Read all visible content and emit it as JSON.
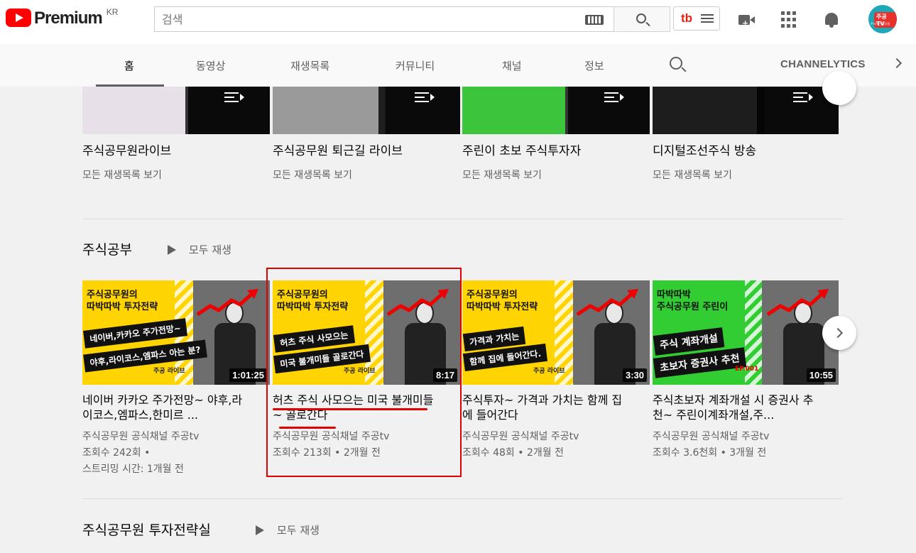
{
  "masthead": {
    "logo_text": "Premium",
    "country": "KR",
    "search_placeholder": "검색",
    "tubebuddy_label": "tb"
  },
  "channel_tabs": {
    "items": [
      "홈",
      "동영상",
      "재생목록",
      "커뮤니티",
      "채널",
      "정보"
    ],
    "active": "홈",
    "extension": "CHANNELYTICS"
  },
  "playlists": [
    {
      "title": "주식공무원라이브",
      "link": "모든 재생목록 보기"
    },
    {
      "title": "주식공무원 퇴근길 라이브",
      "link": "모든 재생목록 보기"
    },
    {
      "title": "주린이 초보 주식투자자",
      "link": "모든 재생목록 보기"
    },
    {
      "title": "디지털조선주식 방송",
      "link": "모든 재생목록 보기"
    }
  ],
  "section1": {
    "title": "주식공부",
    "play_all": "모두 재생",
    "videos": [
      {
        "title": "네이버 카카오 주가전망~ 야후,라이코스,엠파스,한미르 ...",
        "channel": "주식공무원 공식채널 주공tv",
        "meta1": "조회수 242회 •",
        "meta2": "스트리밍 시간: 1개월 전",
        "duration": "1:01:25",
        "thumb_headline": "주식공무원의\n따박따박 투자전략",
        "thumb_banner1": "네이버,카카오 주가전망~",
        "thumb_banner2": "야후,라이코스,엠파스 아는 분?",
        "thumb_brand": "주공 라이브"
      },
      {
        "title": "허츠 주식 사모으는 미국 불개미들~ 골로간다",
        "channel": "주식공무원 공식채널 주공tv",
        "meta1": "조회수 213회 • 2개월 전",
        "duration": "8:17",
        "thumb_headline": "주식공무원의\n따박따박 투자전략",
        "thumb_banner1": "허츠 주식 사모으는",
        "thumb_banner2": "미국 불개미들 골로간다",
        "thumb_brand": "주공 라이브"
      },
      {
        "title": "주식투자~ 가격과 가치는 함께 집에 들어간다",
        "channel": "주식공무원 공식채널 주공tv",
        "meta1": "조회수 48회 • 2개월 전",
        "duration": "3:30",
        "thumb_headline": "주식공무원의\n따박따박 투자전략",
        "thumb_banner1": "가격과 가치는",
        "thumb_banner2": "함께 집에 들어간다.",
        "thumb_brand": "주공 라이브"
      },
      {
        "title": "주식초보자 계좌개설 시 증권사 추천~ 주린이계좌개설,주...",
        "channel": "주식공무원 공식채널 주공tv",
        "meta1": "조회수 3.6천회 • 3개월 전",
        "duration": "10:55",
        "thumb_headline": "따박따박\n주식공무원 주린이",
        "thumb_banner1": "주식 계좌개설",
        "thumb_banner2": "초보자 증권사 추천",
        "thumb_brand": "EP.001"
      }
    ]
  },
  "section2": {
    "title": "주식공무원 투자전략실",
    "play_all": "모두 재생"
  },
  "colors": {
    "yellow_thumb": "#ffd400",
    "green_thumb": "#32cd32",
    "highlight": "#e00000",
    "yt_red": "#ff0000"
  }
}
